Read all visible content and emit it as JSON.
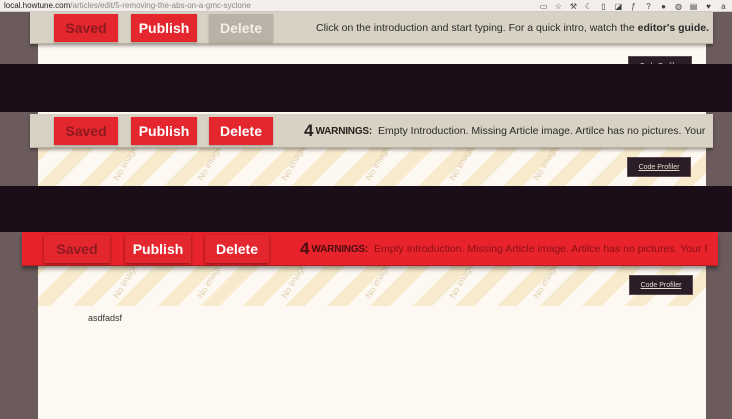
{
  "browser": {
    "url_host": "local.howtune.com",
    "url_path": "/articles/edit/5-removing-the-abs-on-a-gmc-syclone",
    "toolbar_icons": [
      "bookmark-icon",
      "star-icon",
      "wrench-icon",
      "moon-icon",
      "phone-icon",
      "tag-icon",
      "font-icon",
      "help-icon",
      "globe-icon",
      "cookie-icon",
      "stamp-icon",
      "shield-icon",
      "amazon-icon"
    ]
  },
  "panel1": {
    "buttons": {
      "saved": "Saved",
      "publish": "Publish",
      "delete": "Delete"
    },
    "message": "Click on the introduction and start typing.  For a quick intro, watch the",
    "message_link": "editor's guide.",
    "profiler": "Code Profiler"
  },
  "panel2": {
    "buttons": {
      "saved": "Saved",
      "publish": "Publish",
      "delete": "Delete"
    },
    "warning_count": "4",
    "warning_label": "WARNINGS:",
    "warning_text": "Empty Introduction.  Missing Article image.  Artilce has no pictures.  Your fe...",
    "profiler": "Code Profiler",
    "watermark": "No image"
  },
  "panel3": {
    "buttons": {
      "saved": "Saved",
      "publish": "Publish",
      "delete": "Delete"
    },
    "warning_count": "4",
    "warning_label": "WARNINGS:",
    "warning_text": "Empty Introduction.  Missing Article image.  Artilce has no pictures.  Your fe...",
    "profiler": "Code Profiler",
    "body_text": "asdfadsf",
    "watermark": "No image"
  },
  "colors": {
    "accent_red": "#e4272e",
    "toolbar_gray": "#d8d2c4",
    "dark_band": "#1c0e18",
    "sheet": "#fdf8f1"
  }
}
